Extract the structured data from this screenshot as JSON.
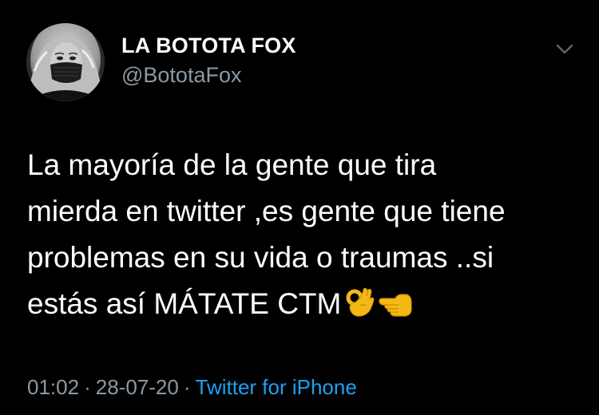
{
  "author": {
    "display_name": "LA BOTOTA FOX",
    "handle": "@BototaFox"
  },
  "tweet": {
    "lines": [
      "La mayoría de la gente que tira",
      "mierda en twitter ,es gente que tiene",
      "problemas en su vida o traumas ..si",
      "estás así MÁTATE CTM"
    ],
    "trailing_emoji": [
      "ok-hand-icon",
      "backhand-index-pointing-left-icon"
    ]
  },
  "meta": {
    "time": "01:02",
    "separator": "·",
    "date": "28-07-20",
    "source": "Twitter for iPhone"
  },
  "colors": {
    "background": "#000000",
    "text": "#ffffff",
    "muted": "#8b98a5",
    "link": "#1da1f2",
    "emoji": "#f5b913"
  },
  "icons": {
    "more_menu": "chevron-down-icon",
    "avatar": "avatar"
  }
}
